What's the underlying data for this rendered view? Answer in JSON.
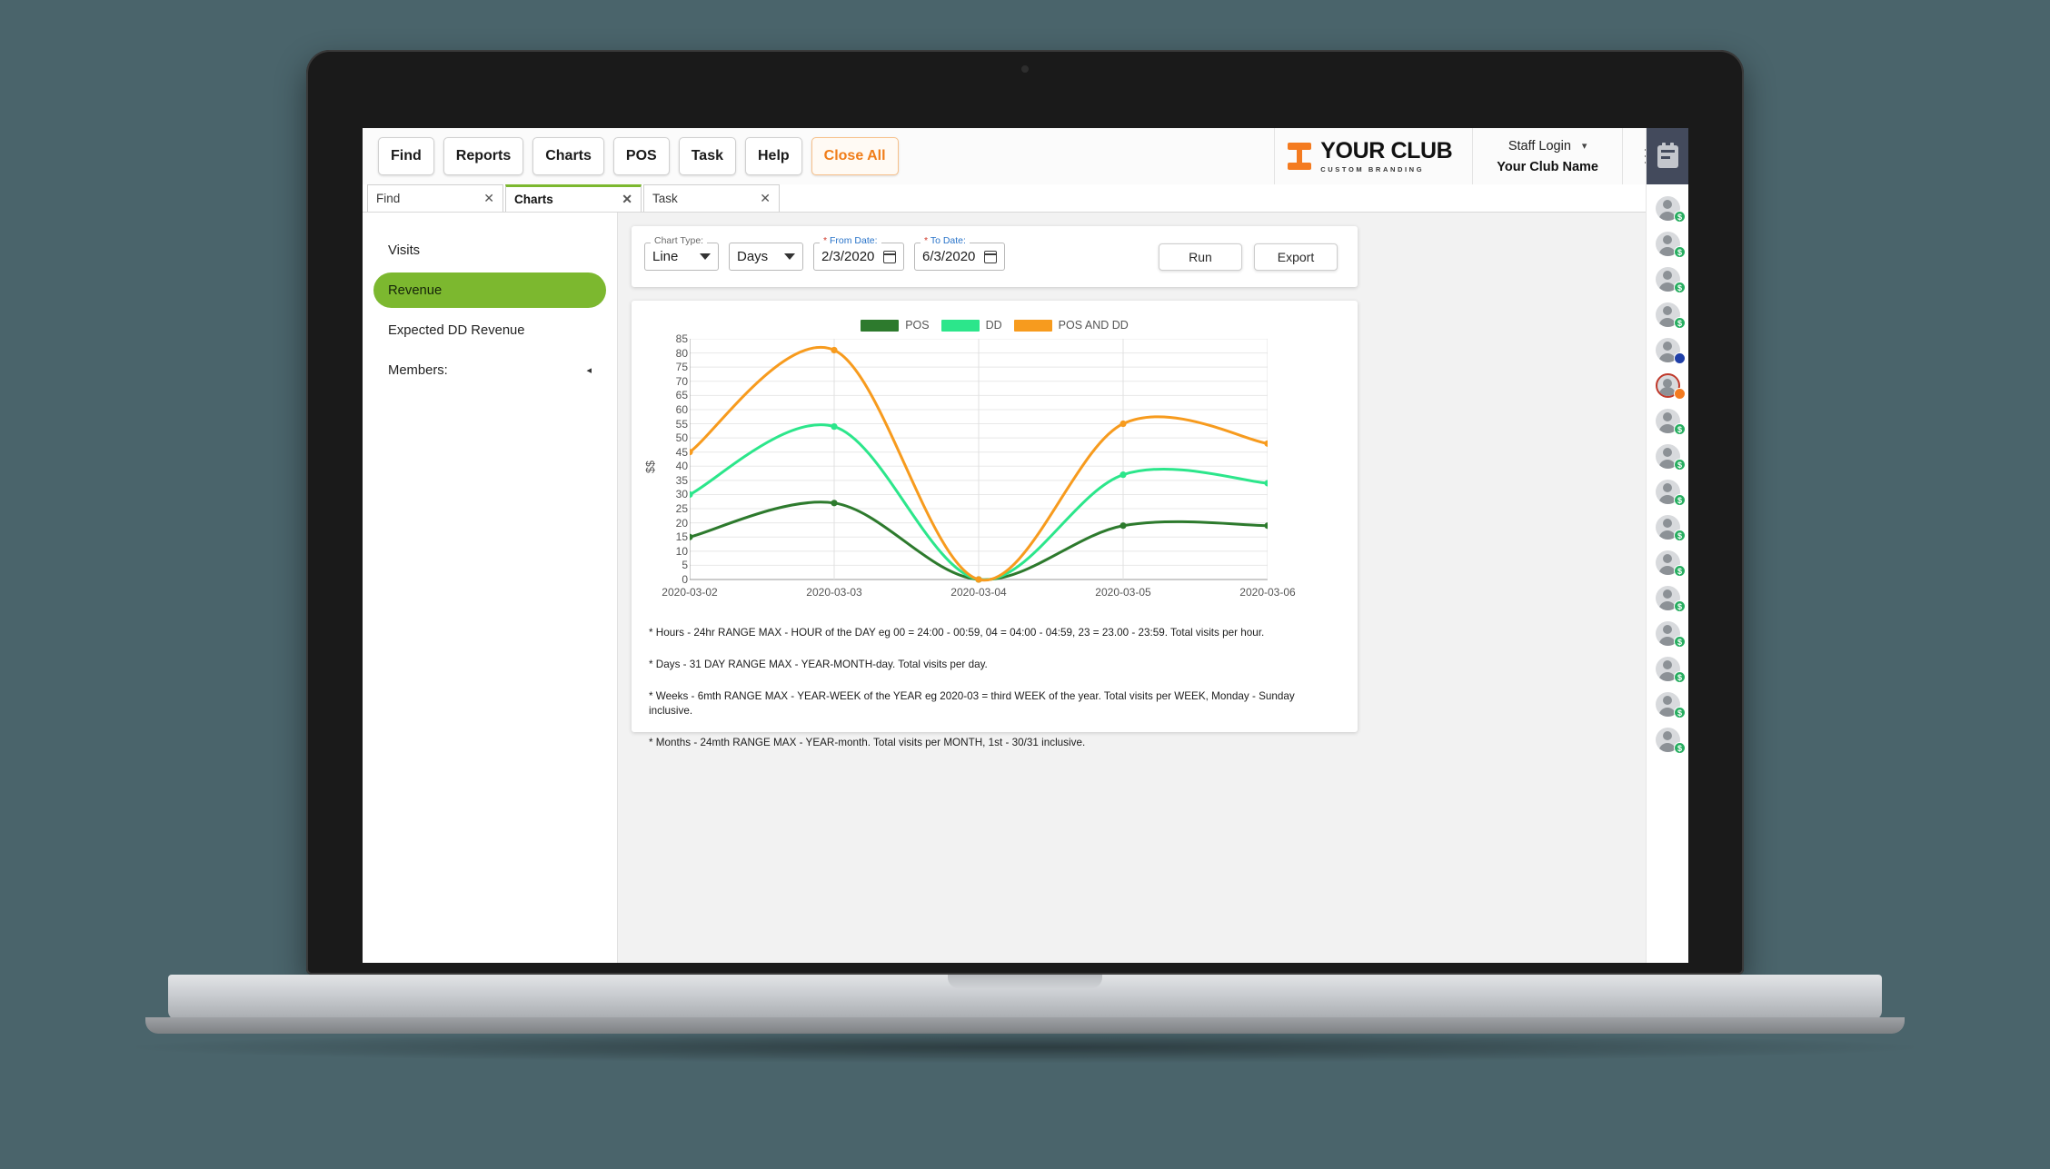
{
  "toolbar": {
    "buttons": [
      {
        "label": "Find",
        "style": "default"
      },
      {
        "label": "Reports",
        "style": "default"
      },
      {
        "label": "Charts",
        "style": "default"
      },
      {
        "label": "POS",
        "style": "default"
      },
      {
        "label": "Task",
        "style": "default"
      },
      {
        "label": "Help",
        "style": "default"
      },
      {
        "label": "Close All",
        "style": "danger"
      }
    ],
    "logo": {
      "main": "YOUR CLUB",
      "sub": "CUSTOM BRANDING"
    },
    "account": {
      "login": "Staff Login",
      "club": "Your Club Name",
      "chevron": "⌄"
    }
  },
  "tabs": [
    {
      "label": "Find",
      "close": "✕",
      "active": false
    },
    {
      "label": "Charts",
      "close": "✕",
      "active": true
    },
    {
      "label": "Task",
      "close": "✕",
      "active": false
    }
  ],
  "sidebar": {
    "items": [
      {
        "label": "Visits",
        "active": false,
        "arrow": ""
      },
      {
        "label": "Revenue",
        "active": true,
        "arrow": ""
      },
      {
        "label": "Expected DD Revenue",
        "active": false,
        "arrow": ""
      },
      {
        "label": "Members:",
        "active": false,
        "arrow": "◂"
      }
    ]
  },
  "controls": {
    "chart_type": {
      "legend": "Chart Type:",
      "value": "Line"
    },
    "period": {
      "legend": "",
      "value": "Days"
    },
    "from_date": {
      "legend": "From Date:",
      "required": "*",
      "value": "2/3/2020"
    },
    "to_date": {
      "legend": "To Date:",
      "required": "*",
      "value": "6/3/2020"
    },
    "run_label": "Run",
    "export_label": "Export"
  },
  "chart_data": {
    "type": "line",
    "title": "",
    "xlabel": "",
    "ylabel": "$$",
    "x": [
      "2020-03-02",
      "2020-03-03",
      "2020-03-04",
      "2020-03-05",
      "2020-03-06"
    ],
    "ylim": [
      0,
      85
    ],
    "yticks": [
      0,
      5,
      10,
      15,
      20,
      25,
      30,
      35,
      40,
      45,
      50,
      55,
      60,
      65,
      70,
      75,
      80,
      85
    ],
    "grid": true,
    "legend_position": "top",
    "series": [
      {
        "name": "POS",
        "color": "#2d7a2d",
        "values": [
          15,
          27,
          0,
          19,
          19
        ]
      },
      {
        "name": "DD",
        "color": "#2ce68b",
        "values": [
          30,
          54,
          0,
          37,
          34
        ]
      },
      {
        "name": "POS AND DD",
        "color": "#f79b1e",
        "values": [
          45,
          81,
          0,
          55,
          48
        ]
      }
    ]
  },
  "notes": [
    "* Hours - 24hr RANGE MAX - HOUR of the DAY eg 00 = 24:00 - 00:59, 04 = 04:00 - 04:59, 23 = 23.00 - 23:59. Total visits per hour.",
    "* Days - 31 DAY RANGE MAX - YEAR-MONTH-day. Total visits per day.",
    "* Weeks - 6mth RANGE MAX - YEAR-WEEK of the YEAR eg 2020-03 = third WEEK of the year. Total visits per WEEK, Monday - Sunday inclusive.",
    "* Months - 24mth RANGE MAX - YEAR-month. Total visits per MONTH, 1st - 30/31 inclusive."
  ],
  "rail": {
    "members": [
      {
        "badge": "$",
        "badge_color": "green",
        "ring": false
      },
      {
        "badge": "$",
        "badge_color": "green",
        "ring": false
      },
      {
        "badge": "$",
        "badge_color": "green",
        "ring": false
      },
      {
        "badge": "$",
        "badge_color": "green",
        "ring": false
      },
      {
        "badge": "",
        "badge_color": "blue",
        "ring": false
      },
      {
        "badge": "",
        "badge_color": "orange",
        "ring": true
      },
      {
        "badge": "$",
        "badge_color": "green",
        "ring": false
      },
      {
        "badge": "$",
        "badge_color": "green",
        "ring": false
      },
      {
        "badge": "$",
        "badge_color": "green",
        "ring": false
      },
      {
        "badge": "$",
        "badge_color": "green",
        "ring": false
      },
      {
        "badge": "$",
        "badge_color": "green",
        "ring": false
      },
      {
        "badge": "$",
        "badge_color": "green",
        "ring": false
      },
      {
        "badge": "$",
        "badge_color": "green",
        "ring": false
      },
      {
        "badge": "$",
        "badge_color": "green",
        "ring": false
      },
      {
        "badge": "$",
        "badge_color": "green",
        "ring": false
      },
      {
        "badge": "$",
        "badge_color": "green",
        "ring": false
      }
    ]
  }
}
